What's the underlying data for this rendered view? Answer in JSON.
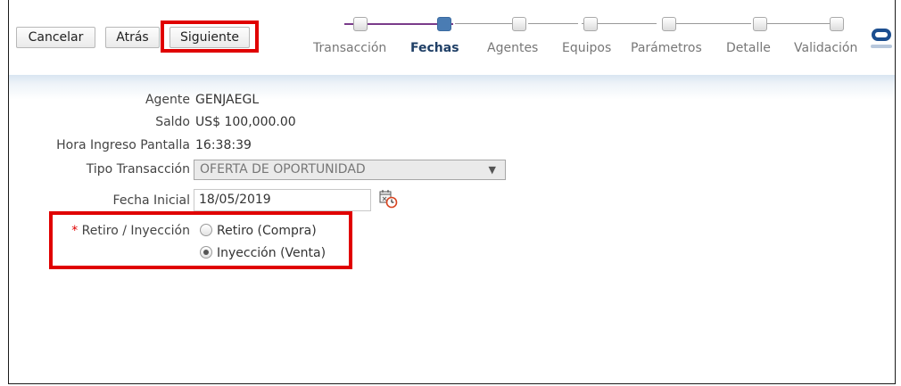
{
  "toolbar": {
    "cancel_label": "Cancelar",
    "back_label": "Atrás",
    "next_label": "Siguiente"
  },
  "train": {
    "steps": [
      {
        "label": "Transacción",
        "state": "visited"
      },
      {
        "label": "Fechas",
        "state": "current"
      },
      {
        "label": "Agentes",
        "state": "unvisited"
      },
      {
        "label": "Equipos",
        "state": "unvisited"
      },
      {
        "label": "Parámetros",
        "state": "unvisited"
      },
      {
        "label": "Detalle",
        "state": "unvisited"
      },
      {
        "label": "Validación",
        "state": "unvisited"
      }
    ]
  },
  "form": {
    "agent_label": "Agente",
    "agent_value": "GENJAEGL",
    "balance_label": "Saldo",
    "balance_value": "US$ 100,000.00",
    "entry_time_label": "Hora Ingreso Pantalla",
    "entry_time_value": "16:38:39",
    "transaction_type_label": "Tipo Transacción",
    "transaction_type_value": "OFERTA DE OPORTUNIDAD",
    "start_date_label": "Fecha Inicial",
    "start_date_value": "18/05/2019",
    "withdraw_inject_required": "*",
    "withdraw_inject_label": " Retiro / Inyección",
    "options": [
      {
        "label": "Retiro (Compra)",
        "selected": false
      },
      {
        "label": "Inyección (Venta)",
        "selected": true
      }
    ]
  },
  "colors": {
    "highlight": "#e00000",
    "current_step": "#4a7cb3",
    "visited_connector": "#7a3b8a",
    "logo": "#1c4e8f"
  },
  "icons": [
    "calendar-clock-icon",
    "oracle-logo-icon",
    "dropdown-arrow-icon"
  ]
}
